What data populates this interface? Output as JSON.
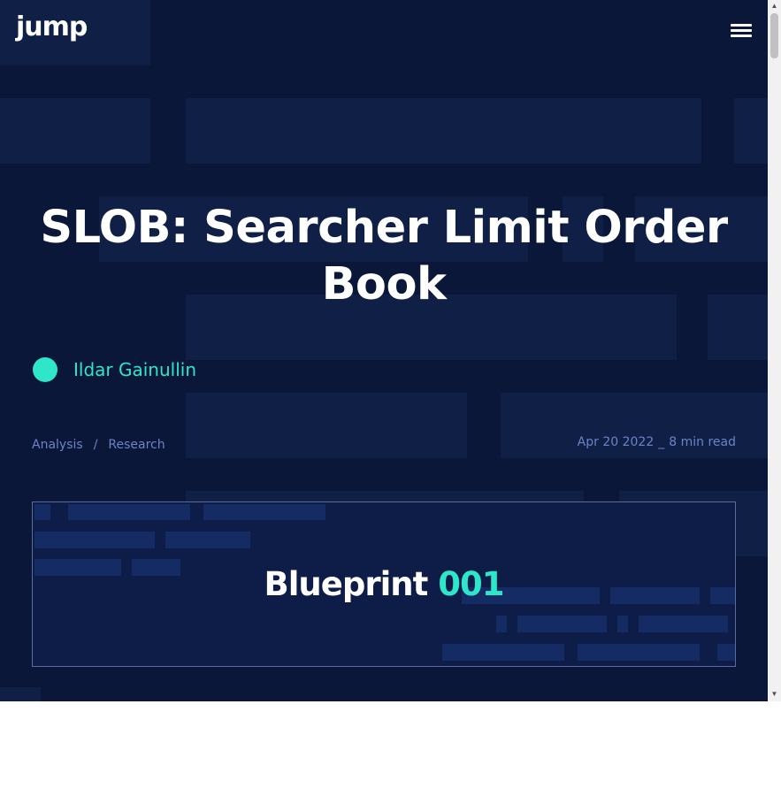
{
  "header": {
    "logo": "jump",
    "menu_icon": "hamburger-menu-icon"
  },
  "article": {
    "title": "SLOB: Searcher Limit Order Book",
    "author": "Ildar Gainullin",
    "categories": [
      "Analysis",
      "Research"
    ],
    "separator": "/",
    "date": "Apr 20 2022",
    "meta_separator": "_",
    "read_time": "8 min read"
  },
  "banner": {
    "word": "Blueprint",
    "number": "001"
  },
  "colors": {
    "background": "#0a1738",
    "accent": "#2ee6c9",
    "muted_text": "#6d83c5"
  }
}
